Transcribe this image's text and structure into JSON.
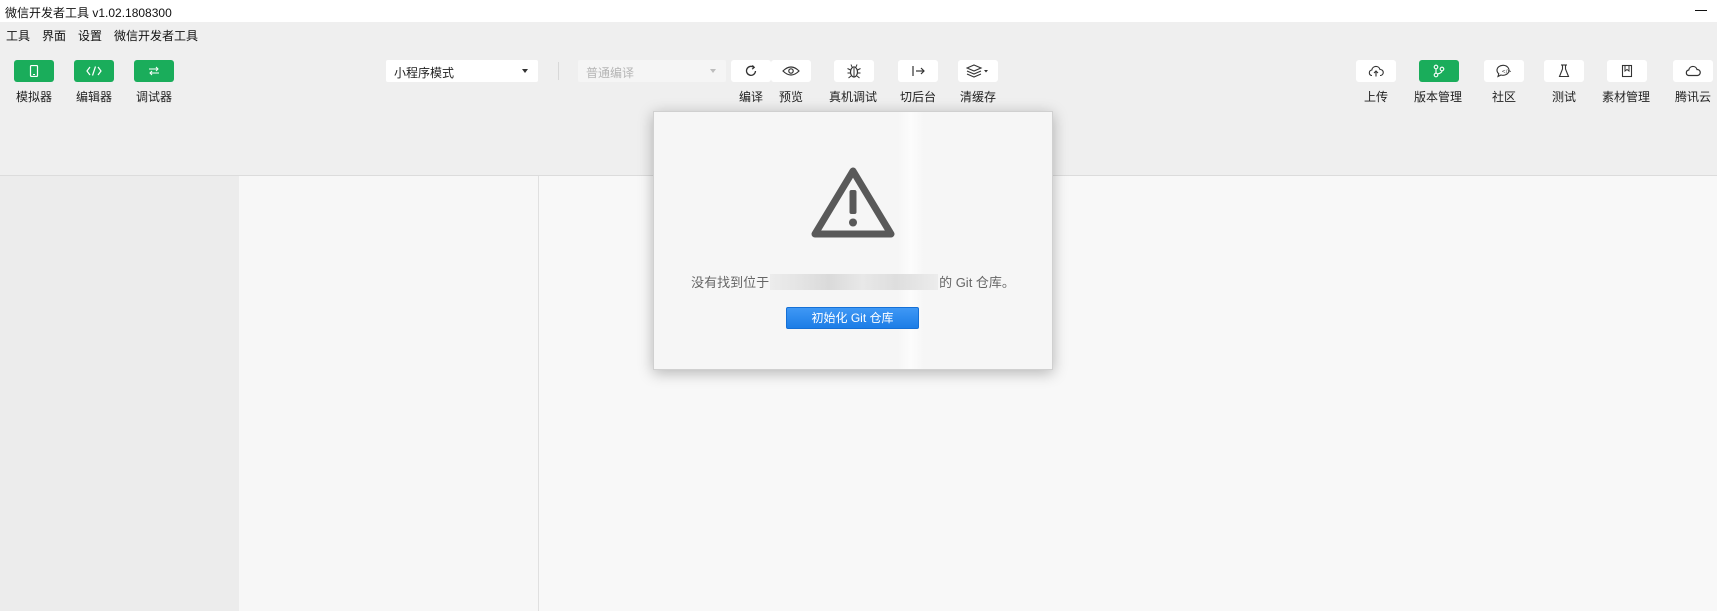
{
  "window": {
    "title": "微信开发者工具 v1.02.1808300"
  },
  "menu": {
    "items": [
      "工具",
      "界面",
      "设置",
      "微信开发者工具"
    ]
  },
  "toolbar": {
    "left_buttons": [
      {
        "label": "模拟器",
        "icon": "phone-icon"
      },
      {
        "label": "编辑器",
        "icon": "code-icon"
      },
      {
        "label": "调试器",
        "icon": "debug-arrows-icon"
      }
    ],
    "mode_select": {
      "value": "小程序模式"
    },
    "compile_select": {
      "value": "普通编译"
    },
    "middle_buttons": [
      {
        "label": "编译",
        "icon": "refresh-icon"
      },
      {
        "label": "预览",
        "icon": "eye-icon"
      },
      {
        "label": "真机调试",
        "icon": "bug-icon"
      },
      {
        "label": "切后台",
        "icon": "switch-background-icon"
      },
      {
        "label": "清缓存",
        "icon": "layers-icon"
      }
    ],
    "right_buttons": [
      {
        "label": "上传",
        "icon": "cloud-upload-icon"
      },
      {
        "label": "版本管理",
        "icon": "git-branch-icon"
      },
      {
        "label": "社区",
        "icon": "chat-bubble-icon"
      },
      {
        "label": "测试",
        "icon": "flask-icon"
      },
      {
        "label": "素材管理",
        "icon": "bookmark-icon"
      },
      {
        "label": "腾讯云",
        "icon": "cloud-icon"
      }
    ],
    "active_color": "#1aad5b"
  },
  "dialog": {
    "icon": "warning-icon",
    "message_prefix": "没有找到位于",
    "message_suffix": "的 Git 仓库。",
    "button_label": "初始化 Git 仓库",
    "button_color": "#2b8cf0"
  }
}
